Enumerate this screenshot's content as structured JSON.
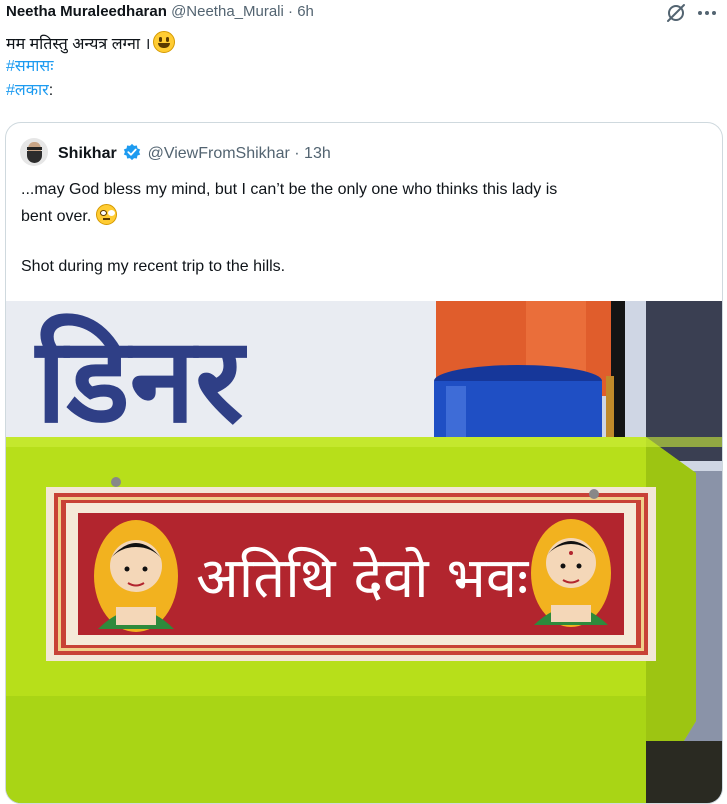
{
  "post": {
    "author_name": "Neetha Muraleedharan",
    "author_handle": "@Neetha_Murali",
    "separator": "·",
    "time": "6h",
    "text": "मम मतिस्तु अन्यत्र लग्ना ।",
    "text_emoji": "grinning-face-emoji",
    "hashtags": [
      "#समासः",
      "#लकार"
    ],
    "hashtag_suffix": ":",
    "icons": {
      "grok": "grok-icon",
      "more": "more-icon"
    }
  },
  "quote": {
    "author_name": "Shikhar",
    "author_handle": "@ViewFromShikhar",
    "separator": "·",
    "time": "13h",
    "lines": [
      "...may God bless my mind, but I can’t be the only one who thinks this lady is",
      "bent over.",
      "Shot during my recent trip to the hills."
    ],
    "emoji": "face-with-rolling-eyes-emoji",
    "verified_badge": "verified-badge-icon",
    "verified_color": "#1d9bf0"
  },
  "photo": {
    "sign_text": "अतिथि देवो भवः",
    "wall_text": "डिनर",
    "colors": {
      "sign_red": "#b2252e",
      "table_green": "#b7df1a",
      "barrel_orange": "#e05d2c",
      "bucket_blue": "#1f4fc4"
    }
  }
}
